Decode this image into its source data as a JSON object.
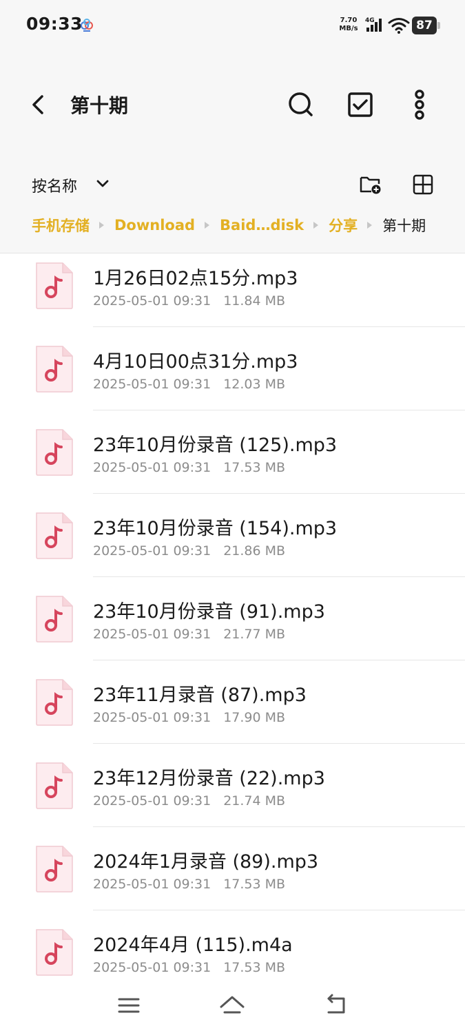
{
  "status": {
    "time": "09:33",
    "speed": "7.70 MB/s",
    "network": "4G",
    "battery": "87",
    "app_icon": "cloud-app-icon"
  },
  "header": {
    "title": "第十期",
    "back_icon": "back-arrow-icon",
    "actions": [
      "search-icon",
      "select-checkbox-icon",
      "more-vertical-icon"
    ]
  },
  "toolbar": {
    "sort_label": "按名称",
    "sort_icon": "chevron-down-icon",
    "new_folder_icon": "new-folder-icon",
    "view_icon": "grid-view-icon"
  },
  "breadcrumb": [
    "手机存储",
    "Download",
    "Baid…disk",
    "分享",
    "第十期"
  ],
  "colors": {
    "accent": "#e3b023",
    "file_icon_bg": "#fdecef",
    "file_icon_note": "#d6455d",
    "meta_text": "#8c8c8c"
  },
  "files": [
    {
      "name": "1月26日02点15分.mp3",
      "date": "2025-05-01 09:31",
      "size": "11.84 MB"
    },
    {
      "name": "4月10日00点31分.mp3",
      "date": "2025-05-01 09:31",
      "size": "12.03 MB"
    },
    {
      "name": "23年10月份录音 (125).mp3",
      "date": "2025-05-01 09:31",
      "size": "17.53 MB"
    },
    {
      "name": "23年10月份录音 (154).mp3",
      "date": "2025-05-01 09:31",
      "size": "21.86 MB"
    },
    {
      "name": "23年10月份录音 (91).mp3",
      "date": "2025-05-01 09:31",
      "size": "21.77 MB"
    },
    {
      "name": "23年11月录音 (87).mp3",
      "date": "2025-05-01 09:31",
      "size": "17.90 MB"
    },
    {
      "name": "23年12月份录音 (22).mp3",
      "date": "2025-05-01 09:31",
      "size": "21.74 MB"
    },
    {
      "name": "2024年1月录音 (89).mp3",
      "date": "2025-05-01 09:31",
      "size": "17.53 MB"
    },
    {
      "name": "2024年4月 (115).m4a",
      "date": "2025-05-01 09:31",
      "size": "17.53 MB"
    }
  ],
  "navbar": [
    "menu-icon",
    "home-icon",
    "back-icon"
  ]
}
